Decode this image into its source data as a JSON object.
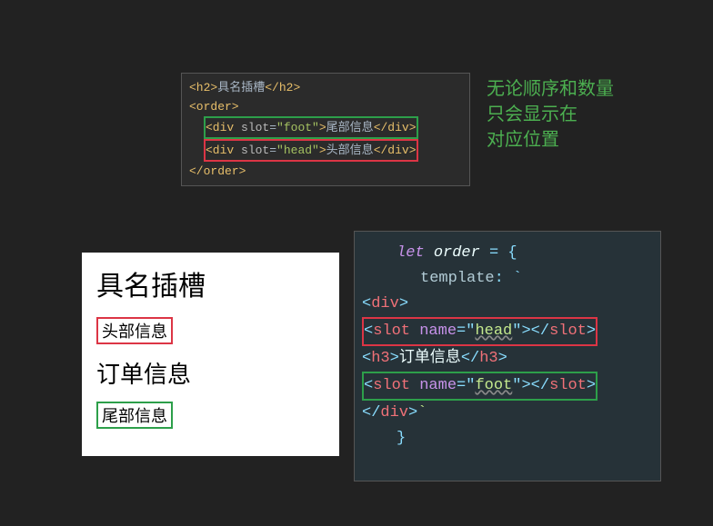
{
  "code1": {
    "l1_open": "<h2>",
    "l1_text": "具名插槽",
    "l1_close": "</h2>",
    "l2": "<order>",
    "l3_open": "<div ",
    "l3_attr": "slot",
    "l3_eq": "=",
    "l3_val": "\"foot\"",
    "l3_close": ">",
    "l3_text": "尾部信息",
    "l3_end": "</div>",
    "l4_open": "<div ",
    "l4_attr": "slot",
    "l4_eq": "=",
    "l4_val": "\"head\"",
    "l4_close": ">",
    "l4_text": "头部信息",
    "l4_end": "</div>",
    "l5": "</order>"
  },
  "annotation": {
    "l1": "无论顺序和数量",
    "l2": "只会显示在",
    "l3": "对应位置"
  },
  "preview": {
    "title": "具名插槽",
    "head": "头部信息",
    "middle": "订单信息",
    "foot": "尾部信息"
  },
  "code2": {
    "l1_let": "let ",
    "l1_ident": "order ",
    "l1_rest": "= {",
    "l2_prop": "template",
    "l2_rest": ": `",
    "l3": "<div>",
    "l4_a": "<slot ",
    "l4_attr": "name",
    "l4_eq": "=\"",
    "l4_val": "head",
    "l4_b": "\"></slot>",
    "l5_a": "<h3>",
    "l5_text": "订单信息",
    "l5_b": "</h3>",
    "l6_a": "<slot ",
    "l6_attr": "name",
    "l6_eq": "=\"",
    "l6_val": "foot",
    "l6_b": "\"></slot>",
    "l7": "</div>",
    "l7_tick": "`",
    "l8": "}"
  }
}
